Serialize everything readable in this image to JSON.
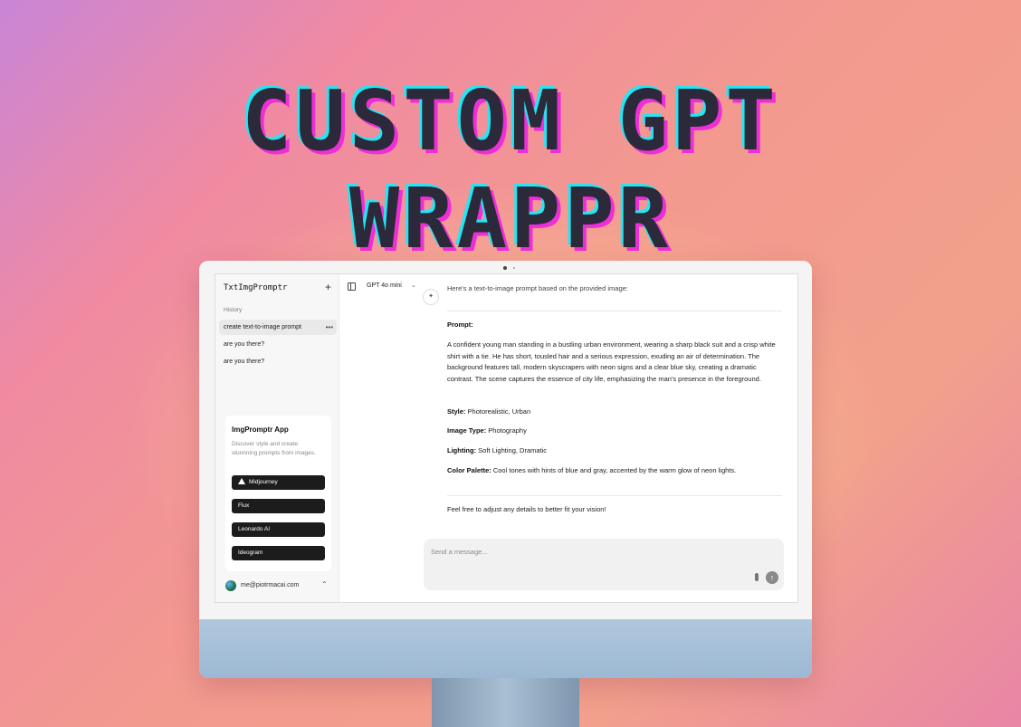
{
  "headline": {
    "line1": "CUSTOM GPT",
    "line2": "WRAPPR"
  },
  "sidebar": {
    "app_title": "TxtImgPromptr",
    "new_chat_icon": "+",
    "history_label": "History",
    "history": [
      {
        "label": "create text-to-image prompt",
        "active": true,
        "more": "•••"
      },
      {
        "label": "are you there?",
        "active": false
      },
      {
        "label": "are you there?",
        "active": false
      }
    ],
    "promo": {
      "title": "ImgPromptr App",
      "description": "Discover style and create stunnning prompts from images.",
      "buttons": [
        "Midjourney",
        "Flux",
        "Leonardo AI",
        "Ideogram"
      ]
    },
    "user": {
      "email": "me@piotrmacai.com",
      "chevron": "⌃"
    }
  },
  "topbar": {
    "model": "GPT 4o mini",
    "chevron": "⌄"
  },
  "conversation": {
    "bot_icon": "✦",
    "intro": "Here's a text-to-image prompt based on the provided image:",
    "prompt_heading": "Prompt:",
    "prompt_text": "A confident young man standing in a bustling urban environment, wearing a sharp black suit and a crisp white shirt with a tie. He has short, tousled hair and a serious expression, exuding an air of determination. The background features tall, modern skyscrapers with neon signs and a clear blue sky, creating a dramatic contrast. The scene captures the essence of city life, emphasizing the man's presence in the foreground.",
    "style_label": "Style:",
    "style_value": " Photorealistic, Urban",
    "type_label": "Image Type:",
    "type_value": " Photography",
    "lighting_label": "Lighting:",
    "lighting_value": " Soft Lighting, Dramatic",
    "palette_label": "Color Palette:",
    "palette_value": " Cool tones with hints of blue and gray, accented by the warm glow of neon lights.",
    "closing": "Feel free to adjust any details to better fit your vision!"
  },
  "composer": {
    "placeholder": "Send a message...",
    "send_icon": "↑"
  },
  "colors": {
    "headline_fill": "#2c2a3a",
    "headline_cyan": "#27e4f2",
    "headline_magenta": "#ee2fd7",
    "button_bg": "#1c1c1c"
  },
  "icons": [
    "plus-icon",
    "sidebar-toggle-icon",
    "chevron-down-icon",
    "more-icon",
    "triangle-icon",
    "avatar",
    "chevron-up-icon",
    "attach-icon",
    "send-arrow-icon"
  ]
}
